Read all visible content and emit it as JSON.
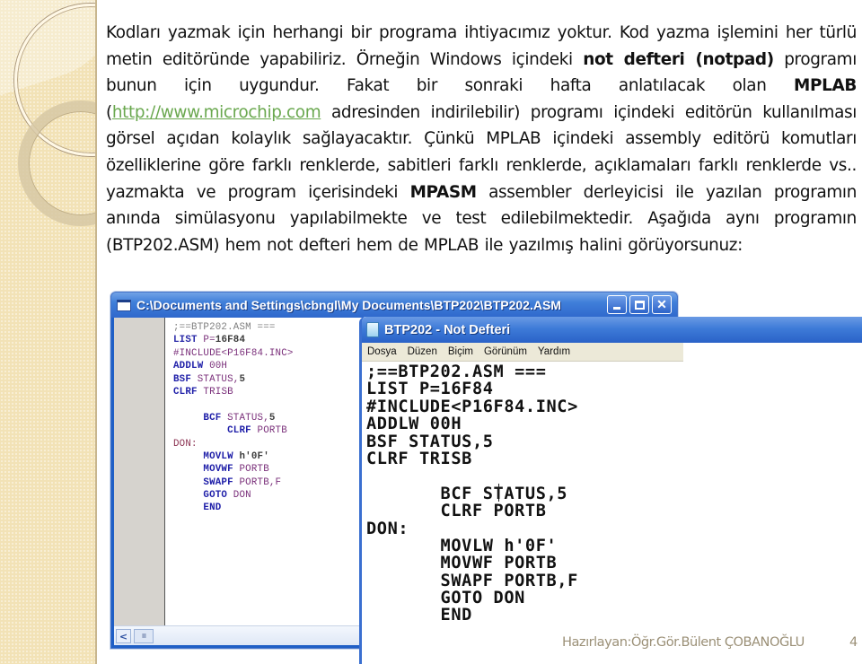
{
  "paragraph": {
    "t1": "Kodları yazmak için herhangi bir programa ihtiyacımız yoktur. Kod yazma işlemini her türlü metin editöründe yapabiliriz. Örneğin Windows içindeki ",
    "b1": "not defteri (notpad)",
    "t2": " programı bunun için uygundur. Fakat bir sonraki hafta anlatılacak olan ",
    "b2": "MPLAB",
    "t3": " (",
    "link": "http://www.microchip.com",
    "t4": " adresinden indirilebilir)  programı içindeki editörün kullanılması görsel açıdan kolaylık sağlayacaktır. Çünkü MPLAB içindeki assembly editörü komutları özelliklerine göre farklı renklerde, sabitleri farklı renklerde, açıklamaları farklı renklerde vs.. yazmakta  ve program içerisindeki ",
    "b3": "MPASM",
    "t5": " assembler derleyicisi ile yazılan programın anında simülasyonu yapılabilmekte ve test edilebilmektedir. Aşağıda aynı programın (BTP202.ASM) hem not defteri hem de MPLAB ile yazılmış halini görüyorsunuz:"
  },
  "link_color": "#6aa84f",
  "mplab_window": {
    "title": "C:\\Documents and Settings\\cbngl\\My Documents\\BTP202\\BTP202.ASM",
    "buttons": {
      "minimize": "",
      "maximize": "",
      "close": "✕"
    },
    "scroll_left": "<",
    "scroll_thumb": "IIII",
    "lines": [
      [
        {
          "t": ";==BTP202.ASM ===",
          "c": "comment"
        }
      ],
      [
        {
          "t": "LIST ",
          "c": "dir"
        },
        {
          "t": "P=",
          "c": "id"
        },
        {
          "t": "16F84",
          "c": "num"
        }
      ],
      [
        {
          "t": "#INCLUDE",
          "c": "id"
        },
        {
          "t": "<P16F84.INC>",
          "c": "id"
        }
      ],
      [
        {
          "t": "ADDLW ",
          "c": "kw"
        },
        {
          "t": "00H",
          "c": "id"
        }
      ],
      [
        {
          "t": "BSF ",
          "c": "kw"
        },
        {
          "t": "STATUS,",
          "c": "id"
        },
        {
          "t": "5",
          "c": "num"
        }
      ],
      [
        {
          "t": "CLRF ",
          "c": "kw"
        },
        {
          "t": "TRISB",
          "c": "id"
        }
      ],
      [
        {
          "t": "",
          "c": "id"
        }
      ],
      [
        {
          "t": "     BCF ",
          "c": "kw"
        },
        {
          "t": "STATUS,",
          "c": "id"
        },
        {
          "t": "5",
          "c": "num"
        }
      ],
      [
        {
          "t": "         CLRF ",
          "c": "kw"
        },
        {
          "t": "PORTB",
          "c": "id"
        }
      ],
      [
        {
          "t": "DON:",
          "c": "label"
        }
      ],
      [
        {
          "t": "     MOVLW ",
          "c": "kw"
        },
        {
          "t": "h'0F'",
          "c": "num"
        }
      ],
      [
        {
          "t": "     MOVWF ",
          "c": "kw"
        },
        {
          "t": "PORTB",
          "c": "id"
        }
      ],
      [
        {
          "t": "     SWAPF ",
          "c": "kw"
        },
        {
          "t": "PORTB,F",
          "c": "id"
        }
      ],
      [
        {
          "t": "     GOTO ",
          "c": "kw"
        },
        {
          "t": "DON",
          "c": "id"
        }
      ],
      [
        {
          "t": "     END",
          "c": "kw"
        }
      ]
    ]
  },
  "notepad_window": {
    "title": "BTP202 - Not Defteri",
    "menu": [
      "Dosya",
      "Düzen",
      "Biçim",
      "Görünüm",
      "Yardım"
    ],
    "lines": [
      ";==BTP202.ASM ===",
      "LIST P=16F84",
      "#INCLUDE<P16F84.INC>",
      "ADDLW 00H",
      "BSF STATUS,5",
      "CLRF TRISB",
      "",
      "       BCF STATUS,5",
      "       CLRF PORTB",
      "DON:",
      "       MOVLW h'0F'",
      "       MOVWF PORTB",
      "       SWAPF PORTB,F",
      "       GOTO DON",
      "       END"
    ]
  },
  "footer": {
    "author": "Hazırlayan:Öğr.Gör.Bülent ÇOBANOĞLU",
    "page_number": "4"
  }
}
